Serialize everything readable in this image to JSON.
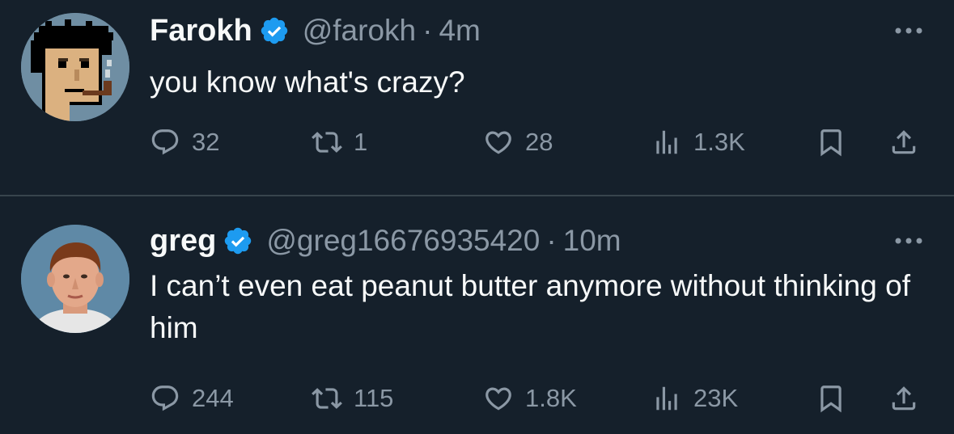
{
  "tweets": [
    {
      "display_name": "Farokh",
      "handle": "@farokh",
      "separator": "·",
      "time": "4m",
      "text": "you know what's crazy?",
      "avatar_icon": "pixel-punk-avatar",
      "replies": "32",
      "reposts": "1",
      "likes": "28",
      "views": "1.3K"
    },
    {
      "display_name": "greg",
      "handle": "@greg16676935420",
      "separator": "·",
      "time": "10m",
      "text": "I can’t even eat peanut butter anymore without thinking of him",
      "avatar_icon": "photo-avatar",
      "replies": "244",
      "reposts": "115",
      "likes": "1.8K",
      "views": "23K"
    }
  ],
  "colors": {
    "background": "#15202b",
    "primary_text": "#f7f9f9",
    "secondary_text": "#8b98a5",
    "verified_badge": "#1d9bf0",
    "divider": "#38444d"
  },
  "icons": {
    "reply": "reply-icon",
    "repost": "repost-icon",
    "like": "heart-icon",
    "views": "views-icon",
    "bookmark": "bookmark-icon",
    "share": "share-icon",
    "more": "more-icon",
    "verified": "verified-badge-icon"
  }
}
